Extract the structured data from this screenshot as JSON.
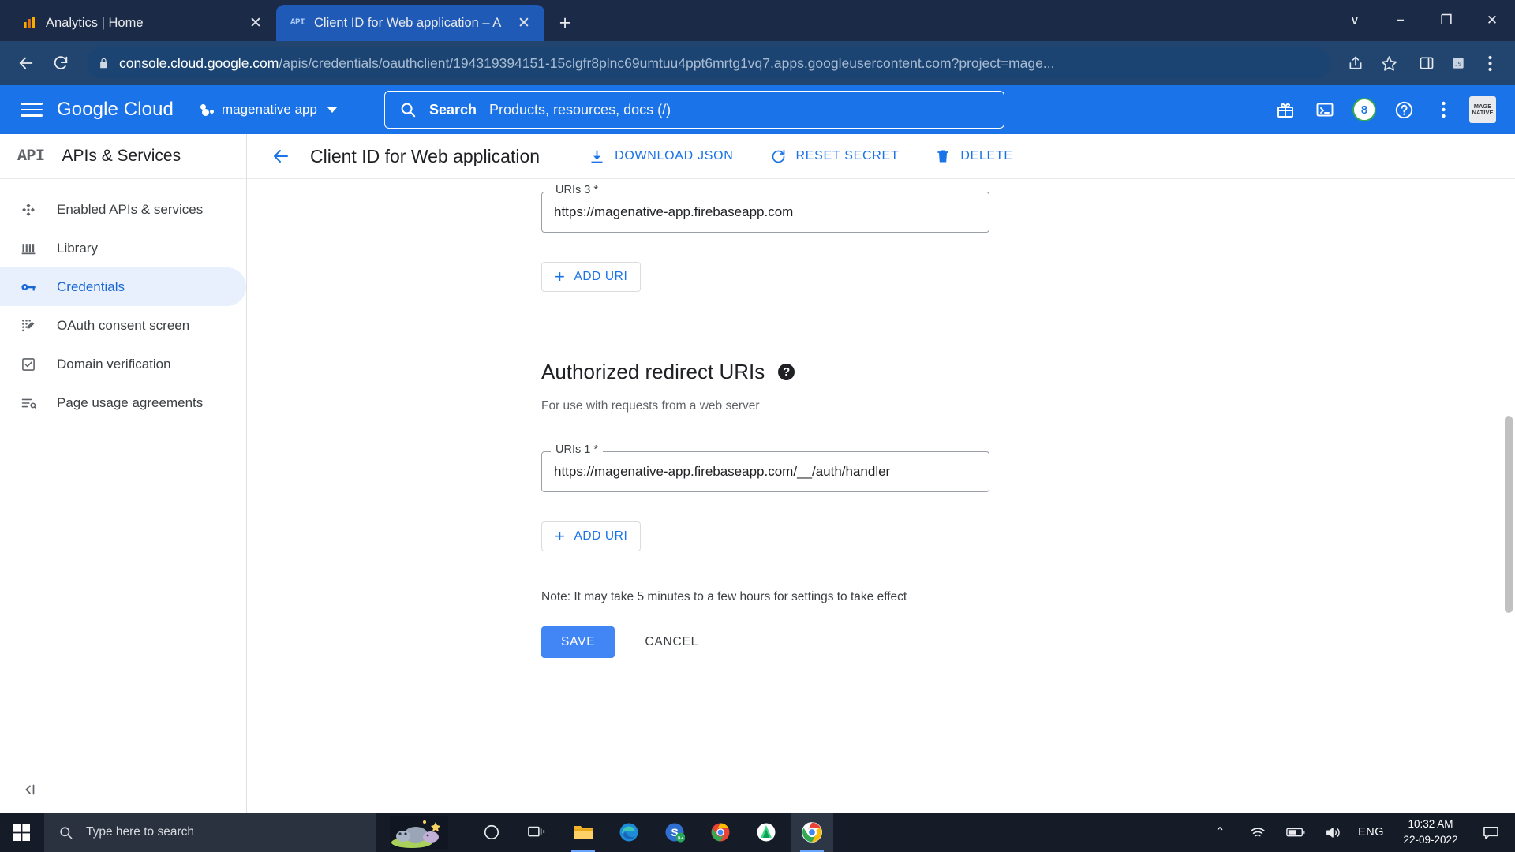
{
  "browser": {
    "tabs": [
      {
        "title": "Analytics | Home",
        "favicon": "analytics-bars-icon",
        "active": false
      },
      {
        "title": "Client ID for Web application – A",
        "favicon": "api-icon",
        "active": true
      }
    ],
    "new_tab_label": "+",
    "window_controls": {
      "minimize": "−",
      "maximize": "❐",
      "close": "✕",
      "chevron": "∨"
    },
    "nav": {
      "back": "back-arrow",
      "reload": "reload-icon"
    },
    "omnibox": {
      "lock": "lock-icon",
      "url_domain": "console.cloud.google.com",
      "url_path": "/apis/credentials/oauthclient/194319394151-15clgfr8plnc69umtuu4ppt6mrtg1vq7.apps.googleusercontent.com?project=mage...",
      "share_icon": "share-icon",
      "bookmark_icon": "star-icon"
    },
    "extensions": [
      "sidepanel-icon",
      "extension-icon",
      "menu-kebab-icon"
    ]
  },
  "gc_header": {
    "menu": "hamburger-icon",
    "logo": "Google Cloud",
    "project": "magenative app",
    "search": {
      "label": "Search",
      "placeholder": "Products, resources, docs (/)"
    },
    "icons": {
      "gifts": "gift-icon",
      "cloudshell": "terminal-icon",
      "help": "help-icon",
      "more": "kebab-icon"
    },
    "notification_count": "8",
    "avatar_text": "MAGE\nNATIVE"
  },
  "sidebar": {
    "header": {
      "glyph": "API",
      "title": "APIs & Services"
    },
    "items": [
      {
        "label": "Enabled APIs & services",
        "icon": "dashboard-diamond-icon",
        "active": false
      },
      {
        "label": "Library",
        "icon": "library-icon",
        "active": false
      },
      {
        "label": "Credentials",
        "icon": "key-icon",
        "active": true
      },
      {
        "label": "OAuth consent screen",
        "icon": "consent-screen-icon",
        "active": false
      },
      {
        "label": "Domain verification",
        "icon": "checkbox-icon",
        "active": false
      },
      {
        "label": "Page usage agreements",
        "icon": "agreements-icon",
        "active": false
      }
    ],
    "collapse_icon": "collapse-panel-icon"
  },
  "page": {
    "back_icon": "back-arrow-icon",
    "title": "Client ID for Web application",
    "toolbar": [
      {
        "label": "DOWNLOAD JSON",
        "icon": "download-icon"
      },
      {
        "label": "RESET SECRET",
        "icon": "refresh-icon"
      },
      {
        "label": "DELETE",
        "icon": "trash-icon"
      }
    ],
    "javascript_origins": {
      "uri3_label": "URIs 3 *",
      "uri3_value": "https://magenative-app.firebaseapp.com",
      "add_uri_label": "ADD URI"
    },
    "redirect_section": {
      "title": "Authorized redirect URIs",
      "help_glyph": "?",
      "subtitle": "For use with requests from a web server",
      "uri1_label": "URIs 1 *",
      "uri1_value": "https://magenative-app.firebaseapp.com/__/auth/handler",
      "add_uri_label": "ADD URI"
    },
    "note": "Note: It may take 5 minutes to a few hours for settings to take effect",
    "save_label": "SAVE",
    "cancel_label": "CANCEL"
  },
  "taskbar": {
    "start_icon": "windows-start-icon",
    "search_placeholder": "Type here to search",
    "search_icon": "search-icon",
    "weather_icon": "hippo-widget-icon",
    "pinned": [
      {
        "name": "cortana-icon",
        "glyph": "○"
      },
      {
        "name": "task-view-icon",
        "glyph": "▣"
      },
      {
        "name": "file-explorer-icon",
        "glyph": "📁"
      },
      {
        "name": "microsoft-edge-icon",
        "glyph": "e"
      },
      {
        "name": "snagit-icon",
        "glyph": "S",
        "badge": "9+"
      },
      {
        "name": "chrome-canary-icon",
        "glyph": "C"
      },
      {
        "name": "android-studio-icon",
        "glyph": "A"
      },
      {
        "name": "google-chrome-icon",
        "glyph": "C"
      }
    ],
    "tray": {
      "chevron": "⌃",
      "network": "wifi-icon",
      "battery": "battery-icon",
      "volume": "volume-icon"
    },
    "language": "ENG",
    "time": "10:32 AM",
    "date": "22-09-2022",
    "action_center_icon": "notifications-icon"
  }
}
